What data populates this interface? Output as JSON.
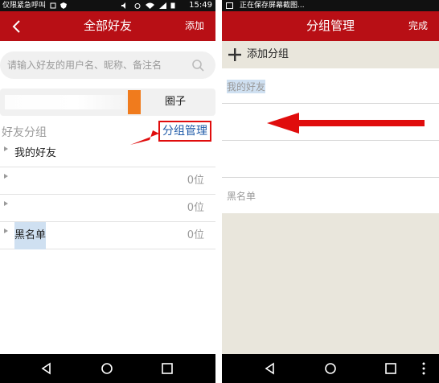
{
  "left": {
    "status": {
      "text": "仅限紧急呼叫",
      "time": "15:49"
    },
    "header": {
      "title": "全部好友",
      "right": "添加"
    },
    "search": {
      "placeholder": "请输入好友的用户名、昵称、备注名"
    },
    "circle": {
      "label": "圈子"
    },
    "groups_title": "好友分组",
    "manage_label": "分组管理",
    "groups": [
      {
        "name": "我的好友",
        "count": ""
      },
      {
        "name": "",
        "count": "0位"
      },
      {
        "name": "",
        "count": "0位"
      },
      {
        "name": "黑名单",
        "count": "0位"
      }
    ]
  },
  "right": {
    "status": {
      "text": "正在保存屏幕截图..."
    },
    "header": {
      "title": "分组管理",
      "right": "完成"
    },
    "add_group": "添加分组",
    "items": [
      "我的好友",
      "",
      "",
      "黑名单"
    ]
  },
  "colors": {
    "accent": "#b80f15",
    "orange": "#f07b1d",
    "link": "#1e5aa8",
    "annotation": "#e00d0d"
  },
  "icons": [
    "back-arrow-icon",
    "search-icon",
    "plus-icon",
    "nav-back-icon",
    "nav-home-icon",
    "nav-recents-icon"
  ]
}
